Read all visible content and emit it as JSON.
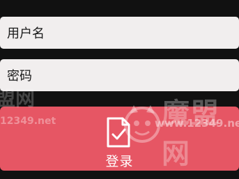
{
  "form": {
    "username_placeholder": "用户名",
    "password_placeholder": "密码",
    "login_label": "登录",
    "login_icon": "document-check-icon",
    "colors": {
      "background": "#111111",
      "field_bg": "#f1eeee",
      "button_bg": "#e65664",
      "button_text": "#ffffff"
    }
  },
  "watermark": {
    "brand": "魔盟网",
    "url": "www.12349.net",
    "left_brand": "盟网",
    "left_url": "12349.net"
  }
}
